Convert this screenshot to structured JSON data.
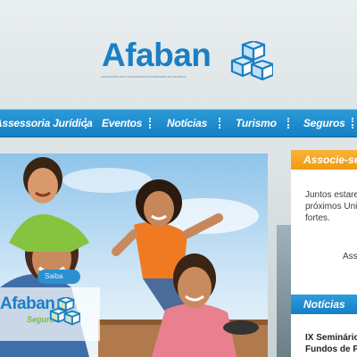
{
  "header": {
    "logo_text": "Afaban",
    "tagline": "ASSOCIAÇÃO DOS FUNCIONÁRIOS APOSENTADOS DO BANRISUL"
  },
  "nav": {
    "items": [
      {
        "label": "Assessoria Jurídica"
      },
      {
        "label": "Eventos"
      },
      {
        "label": "Notícias"
      },
      {
        "label": "Turismo"
      },
      {
        "label": "Seguros"
      }
    ]
  },
  "hero": {
    "badge_title": "Afaban",
    "badge_sub": "Seguros"
  },
  "sidebar": {
    "assoc_head": "Associe-se",
    "assoc_lines": [
      "Juntos estaremos",
      "próximos Uni",
      "fortes."
    ],
    "assoc_label": "Asso",
    "button_label": "Saiba",
    "news_head": "Notícias",
    "news_lines": [
      "IX Seminário de",
      "Fundos de Pen"
    ]
  },
  "colors": {
    "brand_blue": "#1b7fc4",
    "nav_blue": "#1580c4",
    "accent_orange": "#f19a12",
    "accent_green": "#7cbf3a"
  }
}
